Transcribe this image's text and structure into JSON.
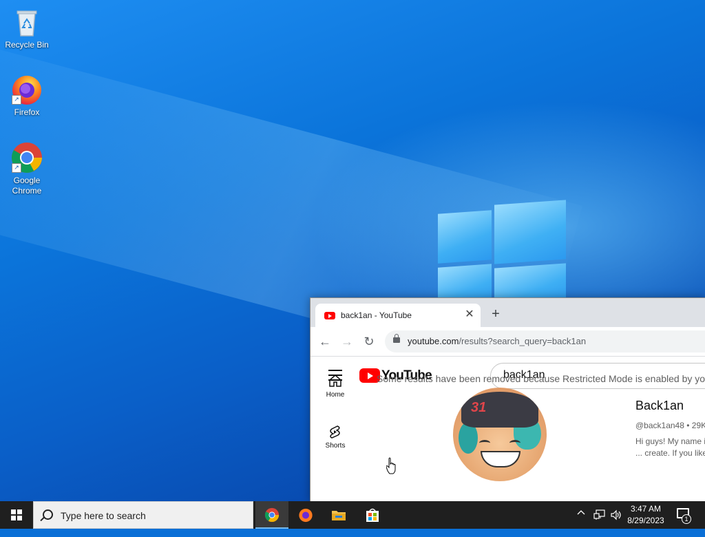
{
  "desktop": {
    "icons": [
      {
        "label": "Recycle Bin"
      },
      {
        "label": "Firefox"
      },
      {
        "label": "Google Chrome"
      }
    ]
  },
  "browser": {
    "tab_title": "back1an - YouTube",
    "tab_close": "✕",
    "new_tab": "+",
    "back": "←",
    "forward": "→",
    "reload": "↻",
    "url_host": "youtube.com",
    "url_path": "/results?search_query=back1an"
  },
  "youtube": {
    "logo_text": "YouTube",
    "search_value": "back1an",
    "guide": [
      {
        "label": "Home"
      },
      {
        "label": "Shorts"
      }
    ],
    "notice": "Some results have been removed because Restricted Mode is enabled by you",
    "channel": {
      "name": "Back1an",
      "meta": "@back1an48 • 29K",
      "description": "Hi guys! My name is ... create. If you like m",
      "avatar_text": "31"
    }
  },
  "taskbar": {
    "search_placeholder": "Type here to search",
    "time": "3:47 AM",
    "date": "8/29/2023",
    "notification_count": "1",
    "tray_chevron": "^",
    "volume_icon": "🔊"
  },
  "colors": {
    "taskbar": "#1f1f1f",
    "youtube_red": "#ff0000",
    "desktop_blue": "#0b74da"
  }
}
